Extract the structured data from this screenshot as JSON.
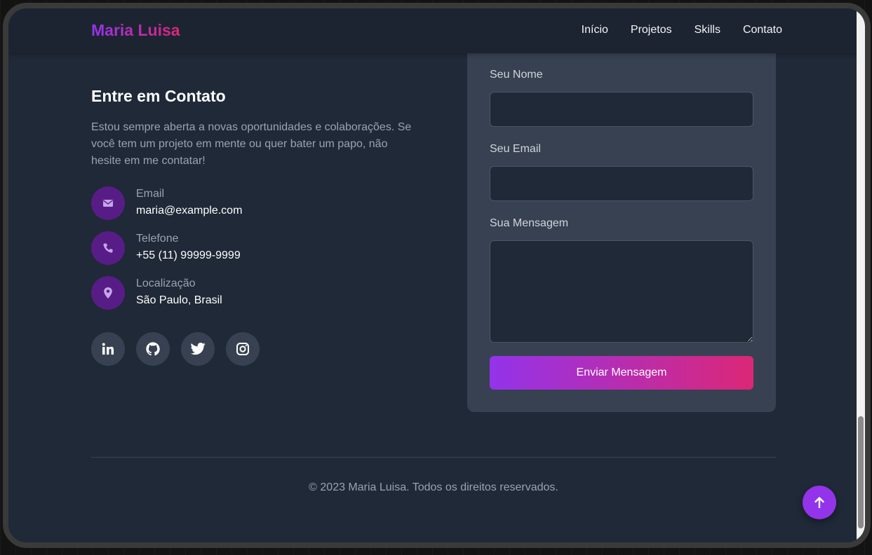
{
  "header": {
    "brand": "Maria Luisa",
    "nav": [
      "Início",
      "Projetos",
      "Skills",
      "Contato"
    ]
  },
  "contact": {
    "title": "Entre em Contato",
    "intro": "Estou sempre aberta a novas oportunidades e colaborações. Se você tem um projeto em mente ou quer bater um papo, não hesite em me contatar!",
    "items": [
      {
        "icon": "envelope-icon",
        "label": "Email",
        "value": "maria@example.com"
      },
      {
        "icon": "phone-icon",
        "label": "Telefone",
        "value": "+55 (11) 99999-9999"
      },
      {
        "icon": "map-pin-icon",
        "label": "Localização",
        "value": "São Paulo, Brasil"
      }
    ],
    "socials": [
      "linkedin-icon",
      "github-icon",
      "twitter-icon",
      "instagram-icon"
    ]
  },
  "form": {
    "name_label": "Seu Nome",
    "name_value": "",
    "email_label": "Seu Email",
    "email_value": "",
    "message_label": "Sua Mensagem",
    "message_value": "",
    "submit_label": "Enviar Mensagem"
  },
  "footer": {
    "copyright": "© 2023 Maria Luisa. Todos os direitos reservados."
  },
  "colors": {
    "accent_start": "#9333ea",
    "accent_end": "#db2777",
    "background": "#1f2937",
    "card": "#374151",
    "icon_circle": "#581c87"
  }
}
